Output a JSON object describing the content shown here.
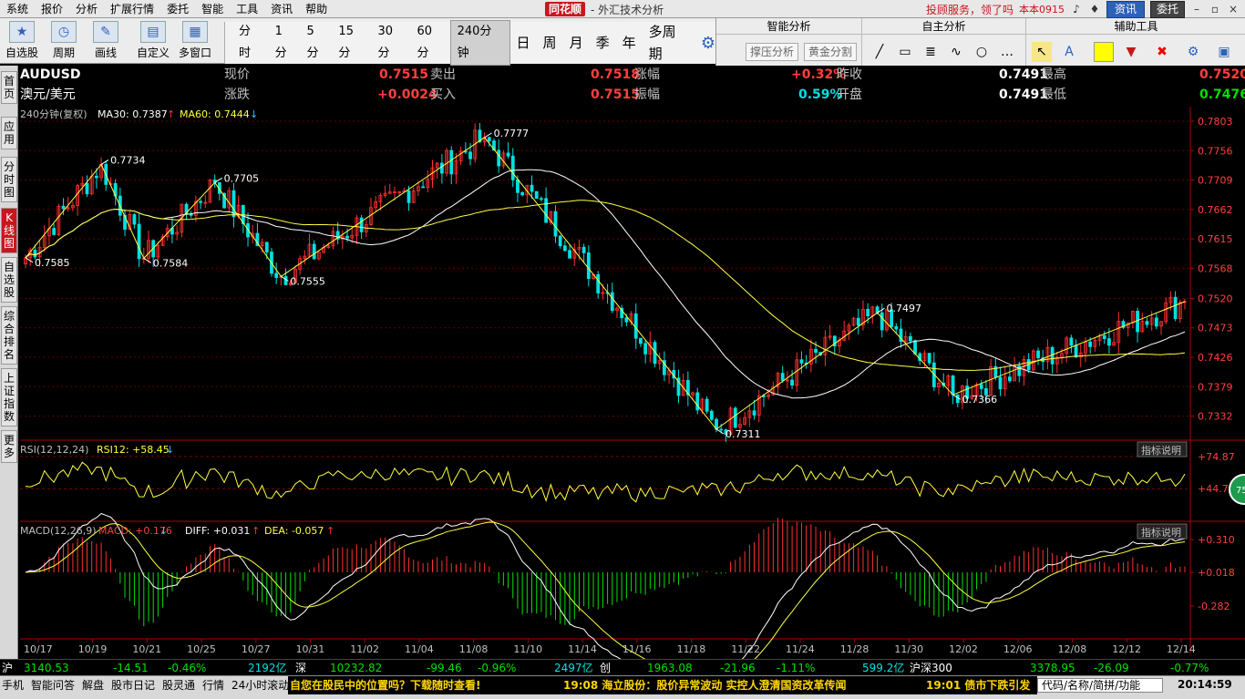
{
  "menu": {
    "items": [
      "系统",
      "报价",
      "分析",
      "扩展行情",
      "委托",
      "智能",
      "工具",
      "资讯",
      "帮助"
    ],
    "brand": "同花顺",
    "subtitle": "- 外汇技术分析",
    "service_link": "投顾服务，领了吗",
    "version": "本本0915",
    "news_btn": "资讯",
    "trade_btn": "委托"
  },
  "toolbar": {
    "buttons": [
      "自选股",
      "周期",
      "画线",
      "自定义",
      "多窗口"
    ],
    "periods": [
      "分时",
      "1分",
      "5分",
      "15分",
      "30分",
      "60分",
      "240分钟",
      "日",
      "周",
      "月",
      "季",
      "年",
      "多周期"
    ],
    "active_period": "240分钟"
  },
  "right_tools": {
    "smart_title": "智能分析",
    "smart_btn1": "撑压分析",
    "smart_btn2": "黄金分割",
    "self_title": "自主分析",
    "aux_title": "辅助工具"
  },
  "quote": {
    "symbol": "AUDUSD",
    "name": "澳元/美元",
    "now_label": "现价",
    "now": "0.7515",
    "chg_label": "涨跌",
    "chg": "+0.0024",
    "sell_label": "卖出",
    "sell": "0.7518",
    "buy_label": "买入",
    "buy": "0.7515",
    "pct_label": "涨幅",
    "pct": "+0.32%",
    "amp_label": "振幅",
    "amp": "0.59%",
    "prev_label": "昨收",
    "prev": "0.7491",
    "open_label": "开盘",
    "open": "0.7491",
    "high_label": "最高",
    "high": "0.7520",
    "low_label": "最低",
    "low": "0.7476"
  },
  "sidebar": [
    "首页",
    "应用",
    "分时图",
    "K线图",
    "自选股",
    "综合排名",
    "上证指数",
    "更多"
  ],
  "chart_data": {
    "type": "candlestick",
    "main_legend": "240分钟(复权)",
    "ma30_label": "MA30: 0.7387",
    "ma60_label": "MA60: 0.7444",
    "y_ticks": [
      "0.7803",
      "0.7756",
      "0.7709",
      "0.7662",
      "0.7615",
      "0.7568",
      "0.7520",
      "0.7473",
      "0.7426",
      "0.7379",
      "0.7332"
    ],
    "ylim": [
      0.7311,
      0.7803
    ],
    "x_ticks": [
      "10/17",
      "10/19",
      "10/21",
      "10/25",
      "10/27",
      "10/31",
      "11/02",
      "11/04",
      "11/08",
      "11/10",
      "11/14",
      "11/16",
      "11/18",
      "11/22",
      "11/24",
      "11/28",
      "11/30",
      "12/02",
      "12/06",
      "12/08",
      "12/12",
      "12/14"
    ],
    "zigzag": [
      {
        "i": 0,
        "v": 0.7585,
        "label": "0.7585"
      },
      {
        "i": 16,
        "v": 0.7734,
        "label": "0.7734"
      },
      {
        "i": 25,
        "v": 0.7584,
        "label": "0.7584"
      },
      {
        "i": 40,
        "v": 0.7705,
        "label": "0.7705"
      },
      {
        "i": 54,
        "v": 0.7555,
        "label": "0.7555"
      },
      {
        "i": 97,
        "v": 0.7777,
        "label": "0.7777"
      },
      {
        "i": 146,
        "v": 0.7311,
        "label": "0.7311"
      },
      {
        "i": 180,
        "v": 0.7497,
        "label": "0.7497"
      },
      {
        "i": 196,
        "v": 0.7366,
        "label": "0.7366"
      },
      {
        "i": 245,
        "v": 0.7515,
        "label": ""
      }
    ],
    "rsi_label": "RSI(12,12,24)",
    "rsi_value": "RSI12: +58.45",
    "rsi_ticks": [
      "+74.87",
      "+44.75"
    ],
    "macd_label": "MACD(12,26,9)",
    "macd_value": "MACD: +0.176",
    "diff_value": "DIFF: +0.031",
    "dea_value": "DEA: -0.057",
    "macd_ticks": [
      "+0.310",
      "+0.018",
      "-0.282"
    ],
    "indicator_btn": "指标说明",
    "badge": "75"
  },
  "status": {
    "sh_label": "沪",
    "sh_idx": "3140.53",
    "sh_chg": "-14.51",
    "sh_pct": "-0.46%",
    "sh_amt": "2192亿",
    "sz_label": "深",
    "sz_idx": "10232.82",
    "sz_chg": "-99.46",
    "sz_pct": "-0.96%",
    "sz_amt": "2497亿",
    "cy_label": "创",
    "cy_idx": "1963.08",
    "cy_chg": "-21.96",
    "cy_pct": "-1.11%",
    "cy_amt": "599.2亿",
    "hs_label": "沪深300",
    "hs_idx": "3378.95",
    "hs_chg": "-26.09",
    "hs_pct": "-0.77%"
  },
  "bottom": {
    "tabs": [
      "手机",
      "智能问答",
      "解盘",
      "股市日记",
      "股灵通",
      "行情",
      "24小时滚动"
    ],
    "ticker1": "自您在股民中的位置吗？下载随时查看!",
    "ticker2": "19:08 海立股份：股价异常波动 实控人澄清国资改革传闻",
    "ticker3": "19:01 债市下跌引发",
    "search_placeholder": "代码/名称/简拼/功能",
    "clock": "20:14:59"
  }
}
